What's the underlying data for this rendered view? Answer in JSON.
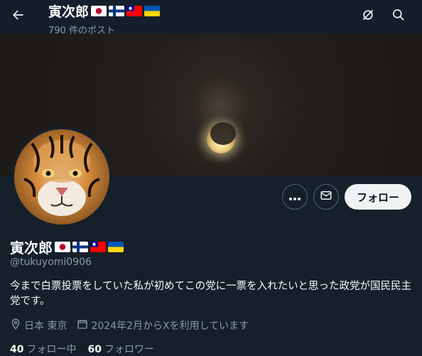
{
  "header": {
    "name": "寅次郎",
    "post_count": "790 件のポスト",
    "back_icon": "arrow-left-icon",
    "actions": [
      "grok-icon",
      "search-icon"
    ]
  },
  "flags": [
    "japan-flag",
    "finland-flag",
    "taiwan-flag",
    "ukraine-flag"
  ],
  "profile": {
    "name": "寅次郎",
    "handle": "@tukuyomi0906",
    "bio": "今まで白票投票をしていた私が初めてこの党に一票を入れたいと思った政党が国民民主党です。",
    "location": "日本 東京",
    "joined": "2024年2月からXを利用しています",
    "following_count": "40",
    "following_label": "フォロー中",
    "followers_count": "60",
    "followers_label": "フォロワー"
  },
  "buttons": {
    "more_icon": "more-icon",
    "message_icon": "mail-icon",
    "follow_label": "フォロー"
  },
  "colors": {
    "background": "#15202b",
    "text_primary": "#f7f9f9",
    "text_secondary": "#8b98a5",
    "follow_button_bg": "#eff3f4"
  }
}
